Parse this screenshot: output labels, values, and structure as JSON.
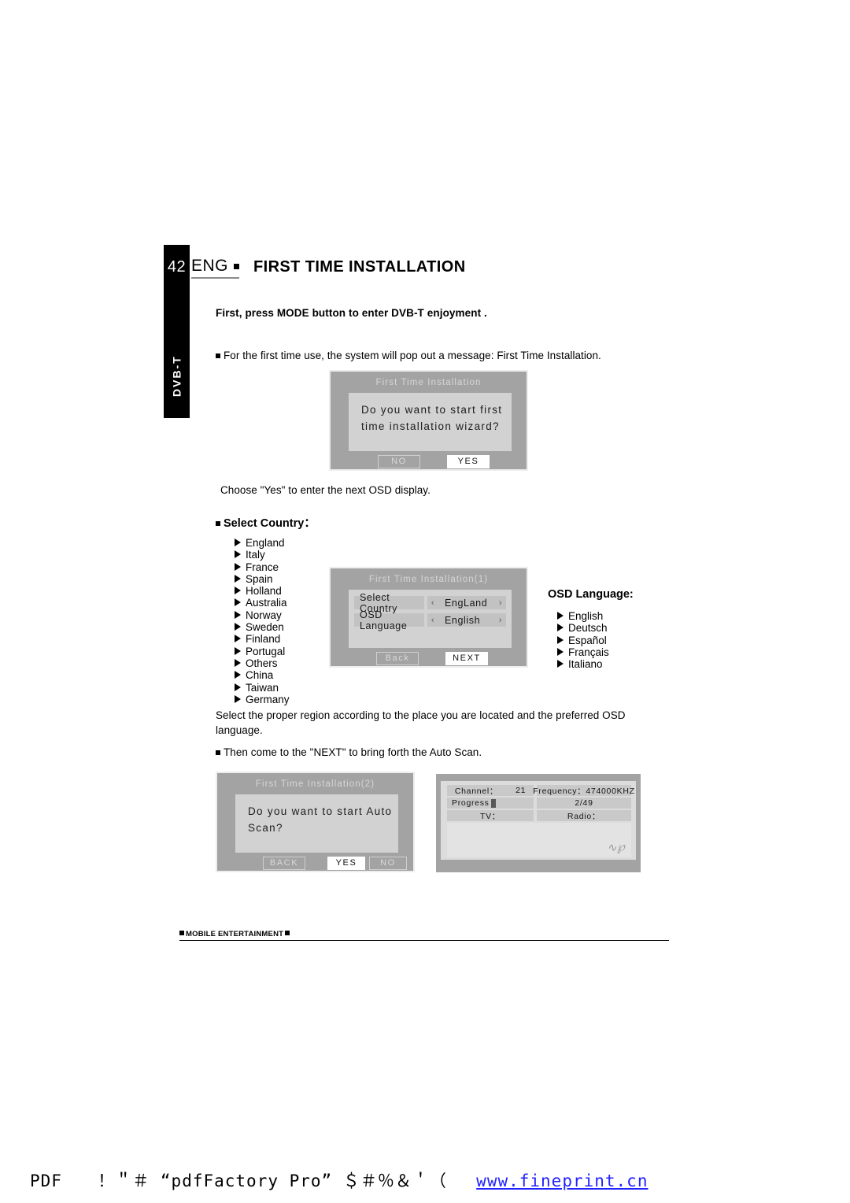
{
  "page": {
    "number": "42",
    "side_label": "DVB-T",
    "section_code": "ENG",
    "title": "FIRST TIME INSTALLATION"
  },
  "body": {
    "lead": "First, press MODE button to enter DVB-T enjoyment .",
    "bullet1": "For the first time use, the system will pop out a message: First Time Installation.",
    "after_dialog1": "Choose \"Yes\" to enter the next OSD display.",
    "select_country_head": "Select Country：",
    "osd_language_head": "OSD Language:",
    "region_note": "Select the proper region according to the place you are located and the preferred OSD language.",
    "bullet2": "Then come to the \"NEXT\" to bring forth the Auto Scan."
  },
  "country_list": [
    "England",
    "Italy",
    "France",
    "Spain",
    "Holland",
    "Australia",
    "Norway",
    "Sweden",
    "Finland",
    "Portugal",
    "Others",
    "China",
    "Taiwan",
    "Germany"
  ],
  "language_list": [
    "English",
    "Deutsch",
    "Español",
    "Français",
    "Italiano"
  ],
  "dialog_wizard": {
    "title": "First Time Installation",
    "message_line1": "Do you want to start first",
    "message_line2": "time installation wizard?",
    "button_no": "NO",
    "button_yes": "YES"
  },
  "dialog_settings": {
    "title": "First Time Installation(1)",
    "rows": [
      {
        "label": "Select Country",
        "value": "EngLand",
        "left_chevron": "‹",
        "right_chevron": "›"
      },
      {
        "label": "OSD Language",
        "value": "English",
        "left_chevron": "‹",
        "right_chevron": "›"
      }
    ],
    "button_back": "Back",
    "button_next": "NEXT"
  },
  "dialog_autoscan": {
    "title": "First Time Installation(2)",
    "message_line1": "Do you want to start Auto",
    "message_line2": "Scan?",
    "button_back": "BACK",
    "button_yes": "YES",
    "button_no": "NO"
  },
  "scan_panel": {
    "channel_label": "Channel：",
    "channel_value": "21",
    "frequency_label": "Frequency：474000KHZ",
    "progress_label": "Progress",
    "progress_value": "2/49",
    "tv_label": "TV：",
    "radio_label": "Radio：",
    "mark": "∿℘"
  },
  "footer": {
    "text": "MOBILE ENTERTAINMENT"
  },
  "watermark": {
    "prefix": "PDF",
    "glyphs_a": "！＂＃",
    "product": "“pdfFactory Pro”",
    "glyphs_b": "＄＃％＆＇（",
    "url": "www.fineprint.cn"
  },
  "colors": {
    "osd_frame": "#a3a3a3",
    "osd_panel": "#d2d2d2",
    "osd_row": "#c2c2c2",
    "highlight": "#ffffff",
    "link": "#2323ff"
  }
}
